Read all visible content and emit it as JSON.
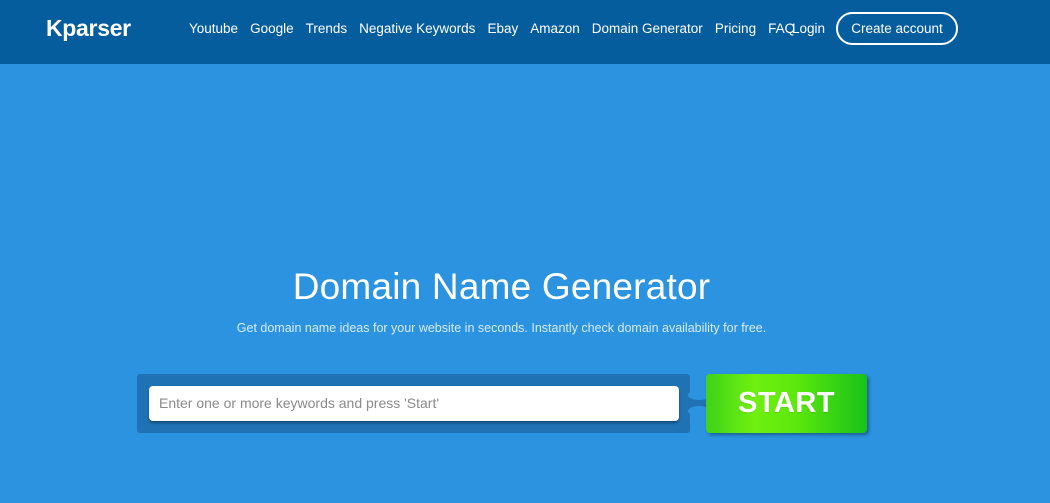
{
  "header": {
    "brand": "Kparser",
    "nav": [
      {
        "label": "Youtube"
      },
      {
        "label": "Google"
      },
      {
        "label": "Trends"
      },
      {
        "label": "Negative Keywords"
      },
      {
        "label": "Ebay"
      },
      {
        "label": "Amazon"
      },
      {
        "label": "Domain Generator"
      },
      {
        "label": "Pricing"
      },
      {
        "label": "FAQ"
      }
    ],
    "login_label": "Login",
    "create_account_label": "Create account"
  },
  "hero": {
    "title": "Domain Name Generator",
    "subtitle": "Get domain name ideas for your website in seconds. Instantly check domain availability for free."
  },
  "search": {
    "placeholder": "Enter one or more keywords and press 'Start'",
    "value": "",
    "start_label": "START"
  },
  "colors": {
    "navbar_bg": "#065d9e",
    "page_bg": "#2b93e0",
    "search_frame": "#1f72b4",
    "start_green": "#5ee80c"
  }
}
